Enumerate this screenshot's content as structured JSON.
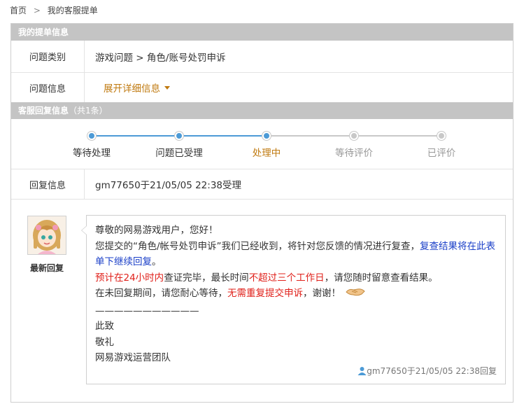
{
  "breadcrumb": {
    "home": "首页",
    "separator": ">",
    "current": "我的客服提单"
  },
  "ticket_section": {
    "title": "我的提单信息",
    "rows": [
      {
        "label": "问题类别",
        "value": "游戏问题 > 角色/账号处罚申诉"
      },
      {
        "label": "问题信息",
        "value": "展开详细信息"
      }
    ]
  },
  "reply_section": {
    "title": "客服回复信息",
    "count": "（共1条）"
  },
  "progress": {
    "current_index": 2,
    "steps": [
      "等待处理",
      "问题已受理",
      "处理中",
      "等待评价",
      "已评价"
    ],
    "colors": {
      "done": "#4c9ad6",
      "current_text": "#c07a10",
      "pending": "#c8c8c8"
    }
  },
  "reply_info": {
    "label": "回复信息",
    "value": "gm77650于21/05/05 22:38受理"
  },
  "latest_reply": {
    "label": "最新回复",
    "greeting": "尊敬的网易游戏用户，您好！",
    "line2_pre": "您提交的“角色/帐号处罚申诉”我们已经收到，将针对您反馈的情况进行复查，",
    "line2_blue": "复查结果将在此表单下继续回复",
    "line2_end": "。",
    "line3_red1": "预计在24小时内",
    "line3_mid": "查证完毕，最长时间",
    "line3_red2": "不超过三个工作日",
    "line3_end": "，请您随时留意查看结果。",
    "line4_pre": "在未回复期间，请您耐心等待，",
    "line4_red": "无需重复提交申诉",
    "line4_end": "，谢谢！",
    "divider": "———————————",
    "sign1": "此致",
    "sign2": "敬礼",
    "sign3": "网易游戏运营团队",
    "meta": "gm77650于21/05/05 22:38回复"
  }
}
